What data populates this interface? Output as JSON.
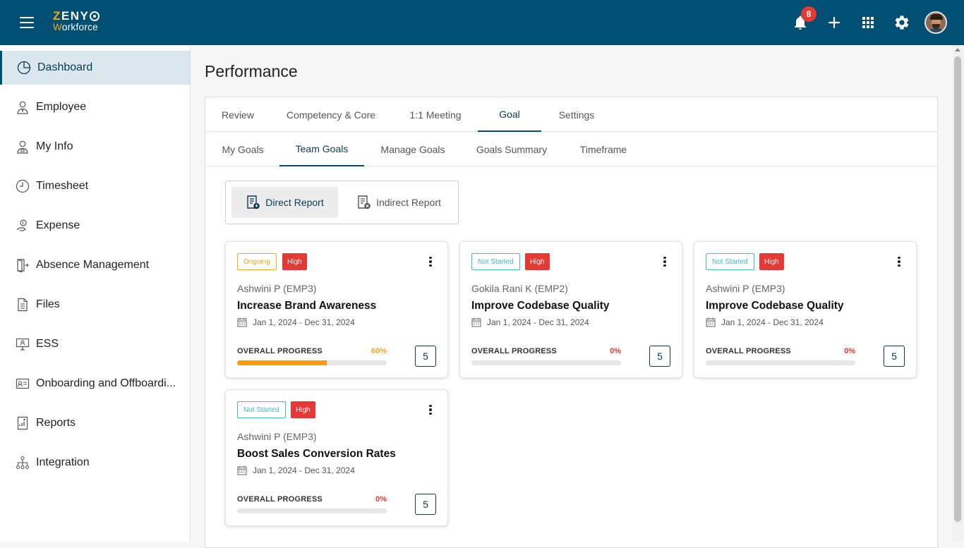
{
  "app": {
    "logo_line1": "ZENY",
    "logo_line2": "Workforce",
    "notification_count": "8"
  },
  "sidebar": {
    "items": [
      {
        "label": "Dashboard",
        "icon": "dashboard-pie-icon",
        "active": true
      },
      {
        "label": "Employee",
        "icon": "employee-icon"
      },
      {
        "label": "My Info",
        "icon": "my-info-icon"
      },
      {
        "label": "Timesheet",
        "icon": "clock-icon"
      },
      {
        "label": "Expense",
        "icon": "expense-hand-icon"
      },
      {
        "label": "Absence Management",
        "icon": "door-exit-icon"
      },
      {
        "label": "Files",
        "icon": "file-icon"
      },
      {
        "label": "ESS",
        "icon": "monitor-user-icon"
      },
      {
        "label": "Onboarding and Offboardi...",
        "icon": "id-card-icon"
      },
      {
        "label": "Reports",
        "icon": "report-icon"
      },
      {
        "label": "Integration",
        "icon": "hierarchy-icon"
      }
    ]
  },
  "page": {
    "title": "Performance",
    "tabs": [
      "Review",
      "Competency & Core",
      "1:1 Meeting",
      "Goal",
      "Settings"
    ],
    "active_tab": "Goal",
    "subtabs": [
      "My Goals",
      "Team Goals",
      "Manage Goals",
      "Goals Summary",
      "Timeframe"
    ],
    "active_subtab": "Team Goals",
    "report_toggle": {
      "direct": "Direct Report",
      "indirect": "Indirect Report",
      "active": "direct"
    }
  },
  "cards": [
    {
      "status": "Ongoing",
      "priority": "High",
      "employee": "Ashwini P (EMP3)",
      "goal": "Increase Brand Awareness",
      "dates": "Jan 1, 2024 - Dec 31, 2024",
      "progress_label": "OVERALL PROGRESS",
      "progress": "60%",
      "progress_value": 0.6,
      "count": "5"
    },
    {
      "status": "Not Started",
      "priority": "High",
      "employee": "Gokila Rani K (EMP2)",
      "goal": "Improve Codebase Quality",
      "dates": "Jan 1, 2024 - Dec 31, 2024",
      "progress_label": "OVERALL PROGRESS",
      "progress": "0%",
      "progress_value": 0,
      "count": "5"
    },
    {
      "status": "Not Started",
      "priority": "High",
      "employee": "Ashwini P (EMP3)",
      "goal": "Improve Codebase Quality",
      "dates": "Jan 1, 2024 - Dec 31, 2024",
      "progress_label": "OVERALL PROGRESS",
      "progress": "0%",
      "progress_value": 0,
      "count": "5"
    },
    {
      "status": "Not Started",
      "priority": "High",
      "employee": "Ashwini P (EMP3)",
      "goal": "Boost Sales Conversion Rates",
      "dates": "Jan 1, 2024 - Dec 31, 2024",
      "progress_label": "OVERALL PROGRESS",
      "progress": "0%",
      "progress_value": 0,
      "count": "5"
    }
  ],
  "colors": {
    "header": "#004e72",
    "accent_orange": "#f5a623",
    "priority_red": "#e53935",
    "not_started_teal": "#3fb8c7",
    "progress_zero_red": "#e53935",
    "progress_orange": "#f5a000"
  }
}
